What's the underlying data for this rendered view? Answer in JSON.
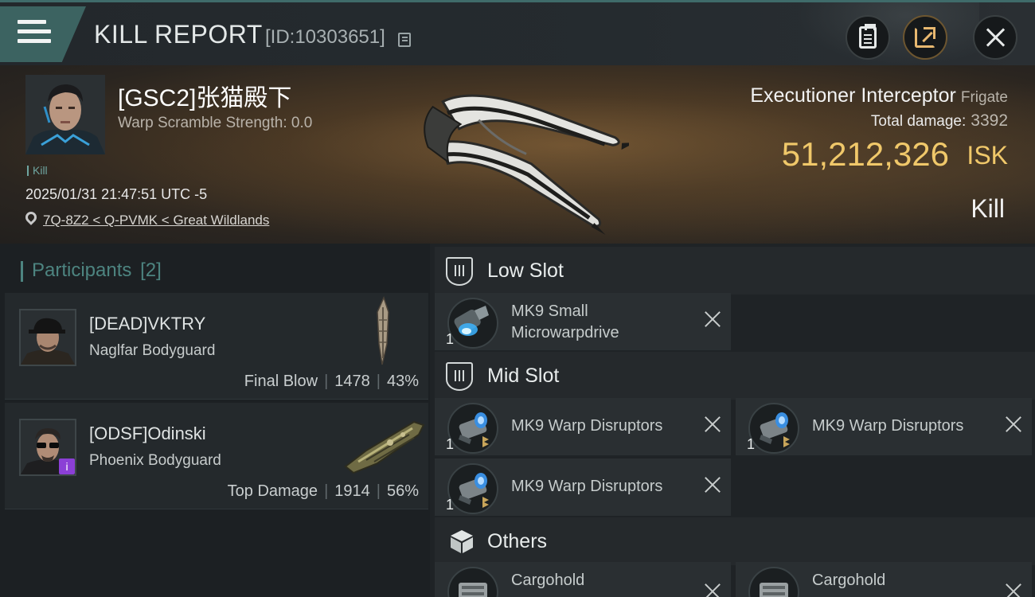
{
  "header": {
    "title": "KILL REPORT",
    "report_id": "[ID:10303651]"
  },
  "victim": {
    "name": "[GSC2]张猫殿下",
    "warp_scramble": "Warp Scramble Strength: 0.0",
    "result_tag": "Kill",
    "timestamp": "2025/01/31 21:47:51 UTC -5",
    "location": "7Q-8Z2 < Q-PVMK < Great Wildlands",
    "ship_name": "Executioner Interceptor",
    "ship_class": "Frigate",
    "total_damage_label": "Total damage:",
    "total_damage": "3392",
    "isk_value": "51,212,326",
    "isk_unit": "ISK",
    "outcome": "Kill"
  },
  "participants": {
    "header": "Participants",
    "count": "[2]",
    "items": [
      {
        "name": "[DEAD]VKTRY",
        "ship": "Naglfar Bodyguard",
        "role": "Final Blow",
        "damage": "1478",
        "percent": "43%"
      },
      {
        "name": "[ODSF]Odinski",
        "ship": "Phoenix Bodyguard",
        "role": "Top Damage",
        "damage": "1914",
        "percent": "56%"
      }
    ]
  },
  "fitting": {
    "low_slot": {
      "title": "Low Slot",
      "modules": [
        {
          "qty": "1",
          "name_line1": "MK9 Small",
          "name_line2": "Microwarpdrive"
        }
      ]
    },
    "mid_slot": {
      "title": "Mid Slot",
      "modules": [
        {
          "qty": "1",
          "name": "MK9 Warp Disruptors"
        },
        {
          "qty": "1",
          "name": "MK9 Warp Disruptors"
        },
        {
          "qty": "1",
          "name": "MK9 Warp Disruptors"
        }
      ]
    },
    "others": {
      "title": "Others",
      "modules": [
        {
          "name": "Cargohold"
        },
        {
          "name": "Cargohold"
        }
      ]
    }
  },
  "colors": {
    "accent_teal": "#4d8480",
    "isk_gold": "#f0c86a",
    "share_orange": "#e8b870"
  }
}
